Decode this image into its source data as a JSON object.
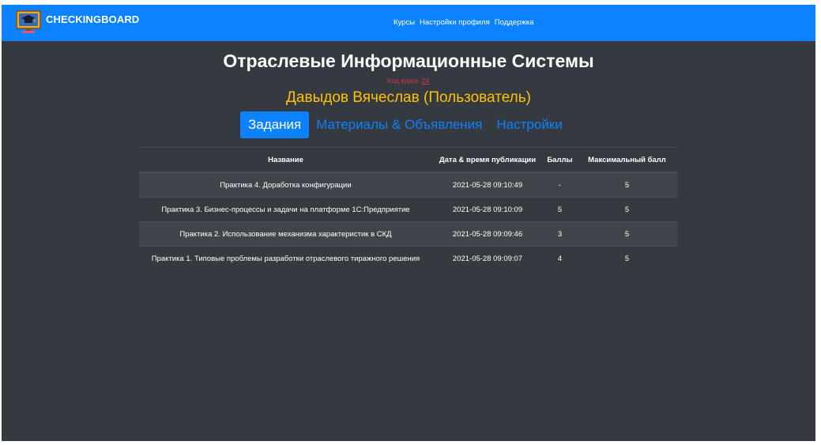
{
  "navbar": {
    "brand": "CHECKINGBOARD",
    "links": [
      "Курсы",
      "Настройки профиля",
      "Поддержка"
    ]
  },
  "course": {
    "title": "Отраслевые Информационные Системы",
    "code_label": "Код курса:",
    "code_value": "24"
  },
  "user": {
    "line": "Давыдов Вячеслав (Пользователь)"
  },
  "tabs": [
    {
      "label": "Задания",
      "active": true
    },
    {
      "label": "Материалы & Объявления",
      "active": false
    },
    {
      "label": "Настройки",
      "active": false
    }
  ],
  "table": {
    "headers": [
      "Название",
      "Дата & время публикации",
      "Баллы",
      "Максимальный балл"
    ],
    "rows": [
      {
        "name": "Практика 4. Доработка конфигурации",
        "date": "2021-05-28 09:10:49",
        "score": "-",
        "max": "5"
      },
      {
        "name": "Практика 3. Бизнес-процессы и задачи на платформе 1С:Предприятие",
        "date": "2021-05-28 09:10:09",
        "score": "5",
        "max": "5"
      },
      {
        "name": "Практика 2. Использование механизма характеристик в СКД",
        "date": "2021-05-28 09:09:46",
        "score": "3",
        "max": "5"
      },
      {
        "name": "Практика 1. Типовые проблемы разработки отраслевого тиражного решения",
        "date": "2021-05-28 09:09:07",
        "score": "4",
        "max": "5"
      }
    ]
  },
  "colors": {
    "primary": "#0d82ff",
    "background": "#343a40",
    "warning": "#ffc107",
    "danger": "#dc3545"
  },
  "icons": {
    "brand_logo": "monitor-graduation-cap-icon"
  }
}
